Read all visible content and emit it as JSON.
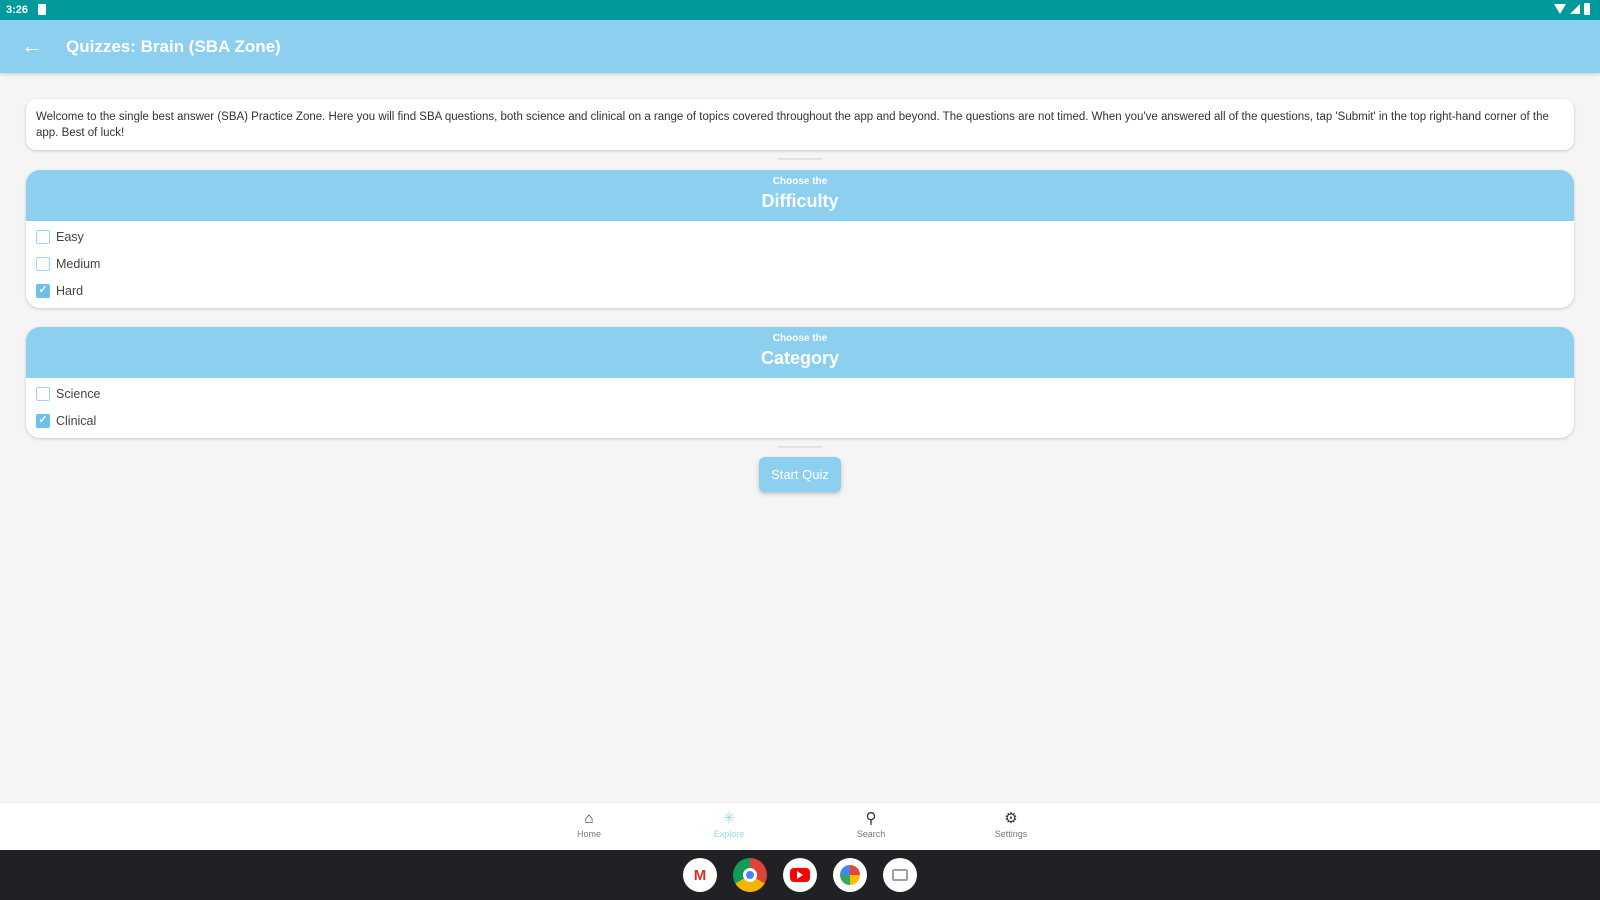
{
  "status_bar": {
    "time": "3:26"
  },
  "app_bar": {
    "title": "Quizzes: Brain (SBA Zone)"
  },
  "intro": {
    "text": "Welcome to the single best answer (SBA) Practice Zone. Here you will find SBA questions, both science and clinical on a range of topics covered throughout the app and beyond. The questions are not timed. When you've answered all of the questions, tap 'Submit' in the top right-hand corner of the app. Best of luck!"
  },
  "difficulty": {
    "pre": "Choose the",
    "title": "Difficulty",
    "options": [
      {
        "label": "Easy",
        "checked": false
      },
      {
        "label": "Medium",
        "checked": false
      },
      {
        "label": "Hard",
        "checked": true
      }
    ]
  },
  "category": {
    "pre": "Choose the",
    "title": "Category",
    "options": [
      {
        "label": "Science",
        "checked": false
      },
      {
        "label": "Clinical",
        "checked": true
      }
    ]
  },
  "start_button": {
    "label": "Start Quiz"
  },
  "bottom_nav": {
    "items": [
      {
        "label": "Home",
        "icon": "home-icon"
      },
      {
        "label": "Explore",
        "icon": "explore-icon",
        "active": true
      },
      {
        "label": "Search",
        "icon": "search-icon"
      },
      {
        "label": "Settings",
        "icon": "gear-icon"
      }
    ]
  },
  "dock": {
    "apps": [
      "gmail",
      "chrome",
      "youtube",
      "photos",
      "apps"
    ]
  },
  "colors": {
    "status_bar": "#009a9a",
    "accent": "#8dcfee",
    "checkbox_checked": "#6cc0ea"
  }
}
